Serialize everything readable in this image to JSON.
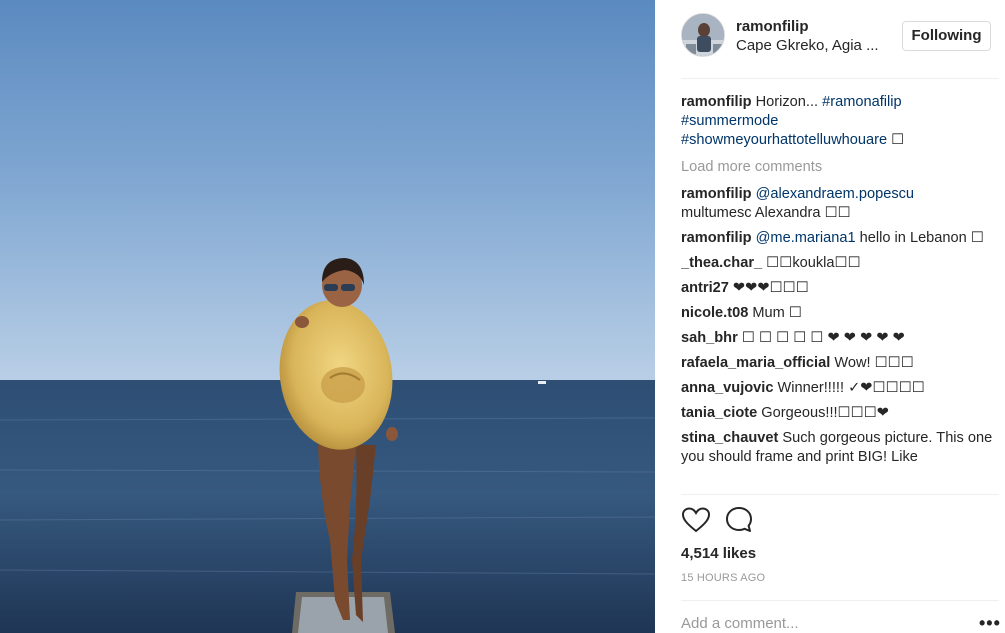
{
  "post": {
    "photo_label": "Woman holding a large straw hat on a pier over the sea"
  },
  "header": {
    "username": "ramonfilip",
    "location": "Cape Gkreko, Agia ...",
    "follow_label": "Following"
  },
  "caption": {
    "user": "ramonfilip",
    "text": " Horizon... ",
    "tags": [
      "#ramonafilip",
      "#summermode",
      "#showmeyourhattotelluwhouare"
    ],
    "tail": " ☐"
  },
  "load_more": "Load more comments",
  "comments": [
    {
      "user": "ramonfilip",
      "mention": "@alexandraem.popescu",
      "text": " multumesc Alexandra ☐☐"
    },
    {
      "user": "ramonfilip",
      "mention": "@me.mariana1",
      "text": " hello in Lebanon ☐"
    },
    {
      "user": "_thea.char_",
      "mention": "",
      "text": " ☐☐koukla☐☐"
    },
    {
      "user": "antri27",
      "mention": "",
      "text": " ❤❤❤☐☐☐"
    },
    {
      "user": "nicole.t08",
      "mention": "",
      "text": " Mum ☐"
    },
    {
      "user": "sah_bhr",
      "mention": "",
      "text": " ☐ ☐ ☐ ☐ ☐ ❤ ❤ ❤ ❤ ❤"
    },
    {
      "user": "rafaela_maria_official",
      "mention": "",
      "text": " Wow! ☐☐☐"
    },
    {
      "user": "anna_vujovic",
      "mention": "",
      "text": " Winner!!!!! ✓❤☐☐☐☐"
    },
    {
      "user": "tania_ciote",
      "mention": "",
      "text": " Gorgeous!!!☐☐☐❤"
    },
    {
      "user": "stina_chauvet",
      "mention": "",
      "text": " Such gorgeous picture. This one you should frame and print BIG! Like"
    }
  ],
  "likes": "4,514 likes",
  "timestamp": "15 HOURS AGO",
  "add_comment": {
    "placeholder": "Add a comment..."
  },
  "more_label": "•••",
  "icons": {
    "like": "heart-icon",
    "comment": "comment-icon",
    "more": "more-options-icon"
  },
  "colors": {
    "link": "#003569",
    "muted": "#999999",
    "text": "#262626",
    "border": "#efefef"
  }
}
